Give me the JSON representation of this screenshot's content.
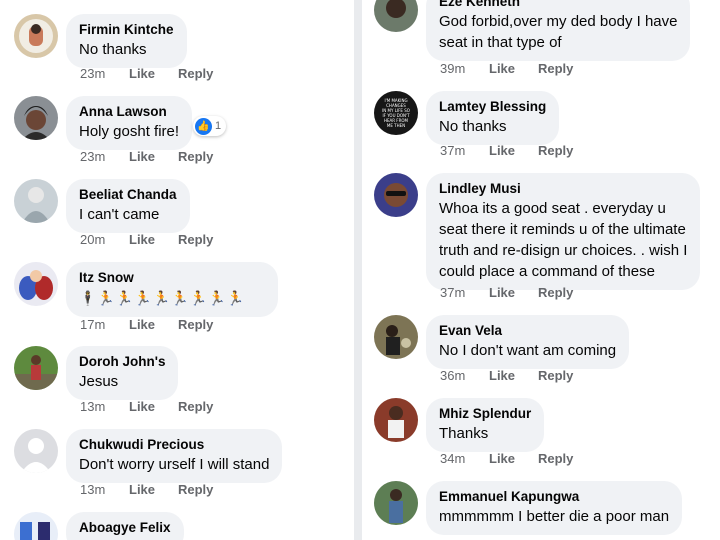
{
  "left_comments": [
    {
      "name": "Firmin Kintche",
      "text": "No thanks",
      "time": "23m",
      "like": "Like",
      "reply": "Reply"
    },
    {
      "name": "Anna Lawson",
      "text": "Holy gosht fire!",
      "time": "23m",
      "like": "Like",
      "reply": "Reply",
      "reaction_count": "1",
      "reaction_icon": "thumbs-up-icon"
    },
    {
      "name": "Beeliat Chanda",
      "text": "I can't came",
      "time": "20m",
      "like": "Like",
      "reply": "Reply"
    },
    {
      "name": "Itz Snow",
      "text": "🕴🏃🏃🏃🏃🏃🏃🏃🏃",
      "time": "17m",
      "like": "Like",
      "reply": "Reply"
    },
    {
      "name": "Doroh John's",
      "text": "Jesus",
      "time": "13m",
      "like": "Like",
      "reply": "Reply"
    },
    {
      "name": "Chukwudi Precious",
      "text": "Don't worry urself I will stand",
      "time": "13m",
      "like": "Like",
      "reply": "Reply"
    },
    {
      "name": "Aboagye Felix",
      "text": "",
      "time": "",
      "like": "",
      "reply": ""
    }
  ],
  "right_comments": [
    {
      "name": "Eze Kenneth",
      "text_lines": [
        "God forbid,over my ded body I  have",
        "seat in that type of"
      ],
      "time": "39m",
      "like": "Like",
      "reply": "Reply"
    },
    {
      "name": "Lamtey Blessing",
      "text_lines": [
        "No thanks"
      ],
      "time": "37m",
      "like": "Like",
      "reply": "Reply",
      "avatar_text": "I'M MAKING CHANGES IN MY LIFE SO IF YOU DON'T HEAR FROM ME THEN"
    },
    {
      "name": "Lindley Musi",
      "text_lines": [
        "Whoa its a good seat . everyday u",
        "seat there it reminds u of the ultimate",
        "truth and re-disign ur choices. . wish I",
        "could place a command of these"
      ],
      "time": "37m",
      "like": "Like",
      "reply": "Reply"
    },
    {
      "name": "Evan Vela",
      "text_lines": [
        "No I don't want am coming"
      ],
      "time": "36m",
      "like": "Like",
      "reply": "Reply"
    },
    {
      "name": "Mhiz Splendur",
      "text_lines": [
        "Thanks"
      ],
      "time": "34m",
      "like": "Like",
      "reply": "Reply"
    },
    {
      "name": "Emmanuel Kapungwa",
      "text_lines": [
        "mmmmmm I better die a poor man"
      ],
      "time": "",
      "like": "",
      "reply": ""
    }
  ],
  "colors": {
    "bubble": "#f0f2f5",
    "meta": "#65676b",
    "like_blue": "#1877f2",
    "divider": "#e9ebee"
  }
}
